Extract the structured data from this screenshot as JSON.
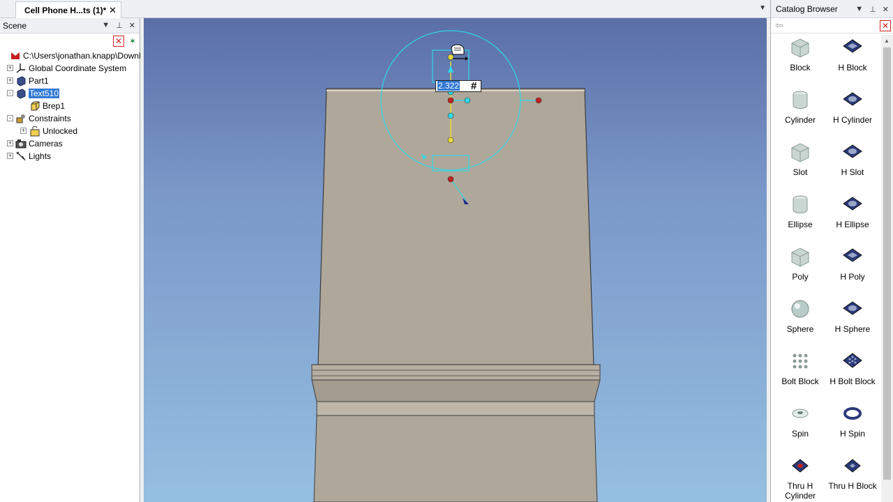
{
  "document_tab": {
    "title": "Cell Phone H...ts (1)*",
    "close": "✕"
  },
  "scene_panel": {
    "title": "Scene",
    "tree": [
      {
        "label": "C:\\Users\\jonathan.knapp\\Downl",
        "icon": "scene-root-icon",
        "expander": ""
      },
      {
        "label": "Global Coordinate System",
        "icon": "axis-icon",
        "expander": "+"
      },
      {
        "label": "Part1",
        "icon": "part-icon",
        "expander": "+"
      },
      {
        "label": "Text510",
        "icon": "part-icon",
        "expander": "-",
        "selected": true
      },
      {
        "label": "Brep1",
        "icon": "brep-cube-icon",
        "expander": ""
      },
      {
        "label": "Constraints",
        "icon": "constraints-icon",
        "expander": "-"
      },
      {
        "label": "Unlocked",
        "icon": "lock-icon",
        "expander": "+"
      },
      {
        "label": "Cameras",
        "icon": "camera-icon",
        "expander": "+"
      },
      {
        "label": "Lights",
        "icon": "light-icon",
        "expander": "+"
      }
    ]
  },
  "viewport": {
    "dimension_value": "2.322",
    "dimension_suffix": "#"
  },
  "catalog_browser": {
    "title": "Catalog Browser",
    "items": [
      {
        "label": "Block"
      },
      {
        "label": "H Block"
      },
      {
        "label": "Cylinder"
      },
      {
        "label": "H Cylinder"
      },
      {
        "label": "Slot"
      },
      {
        "label": "H Slot"
      },
      {
        "label": "Ellipse"
      },
      {
        "label": "H Ellipse"
      },
      {
        "label": "Poly"
      },
      {
        "label": "H Poly"
      },
      {
        "label": "Sphere"
      },
      {
        "label": "H Sphere"
      },
      {
        "label": "Bolt Block"
      },
      {
        "label": "H Bolt Block"
      },
      {
        "label": "Spin"
      },
      {
        "label": "H Spin"
      },
      {
        "label": "Thru H Cylinder"
      },
      {
        "label": "Thru H Block"
      }
    ]
  },
  "colors": {
    "selection": "#3178d4",
    "handle_cyan": "#2fd8e8",
    "model": "#aea79a"
  }
}
